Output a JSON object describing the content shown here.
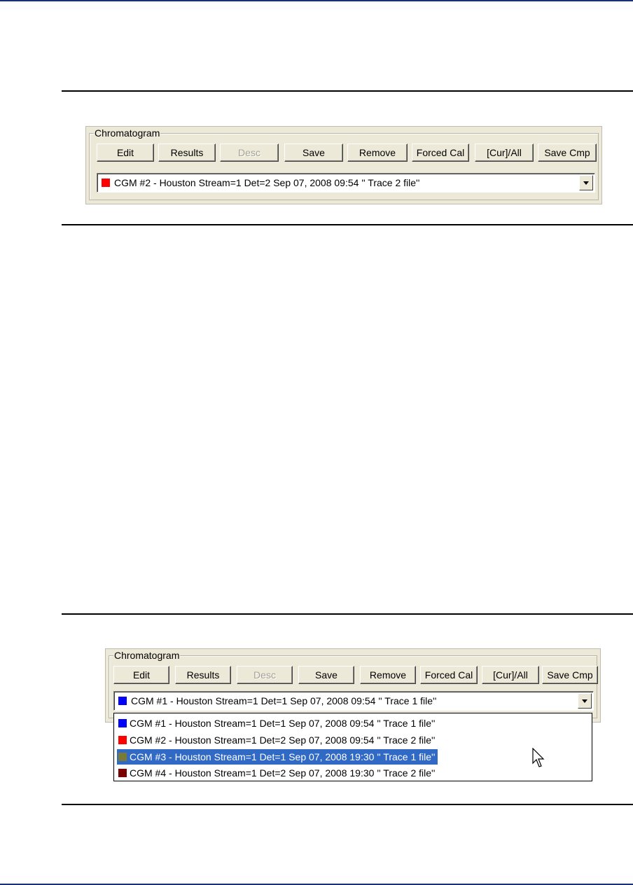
{
  "panel1": {
    "group_label": "Chromatogram",
    "buttons": [
      "Edit",
      "Results",
      "Desc",
      "Save",
      "Remove",
      "Forced Cal",
      "[Cur]/All",
      "Save Cmp"
    ],
    "combo": {
      "swatch_color": "#ff0000",
      "value": "CGM #2 - Houston Stream=1 Det=2 Sep 07, 2008 09:54 '' Trace 2 file''"
    }
  },
  "panel2": {
    "group_label": "Chromatogram",
    "buttons": [
      "Edit",
      "Results",
      "Desc",
      "Save",
      "Remove",
      "Forced Cal",
      "[Cur]/All",
      "Save Cmp"
    ],
    "combo": {
      "swatch_color": "#0000ff",
      "value": "CGM #1 - Houston Stream=1 Det=1 Sep 07, 2008 09:54 '' Trace 1 file''"
    },
    "options": [
      {
        "swatch_color": "#0000ff",
        "label": "CGM #1 - Houston Stream=1 Det=1 Sep 07, 2008 09:54 '' Trace 1 file''",
        "selected": false
      },
      {
        "swatch_color": "#ff0000",
        "label": "CGM #2 - Houston Stream=1 Det=2 Sep 07, 2008 09:54 '' Trace 2 file''",
        "selected": false
      },
      {
        "swatch_color": "#7a7a38",
        "label": "CGM #3 - Houston Stream=1 Det=1 Sep 07, 2008 19:30 '' Trace 1 file''",
        "selected": true
      },
      {
        "swatch_color": "#7a0000",
        "label": "CGM #4 - Houston Stream=1 Det=2 Sep 07, 2008 19:30 '' Trace 2 file''",
        "selected": false
      }
    ]
  },
  "icons": {
    "cursor": "mouse-pointer-icon",
    "dropdown": "chevron-down-icon"
  }
}
